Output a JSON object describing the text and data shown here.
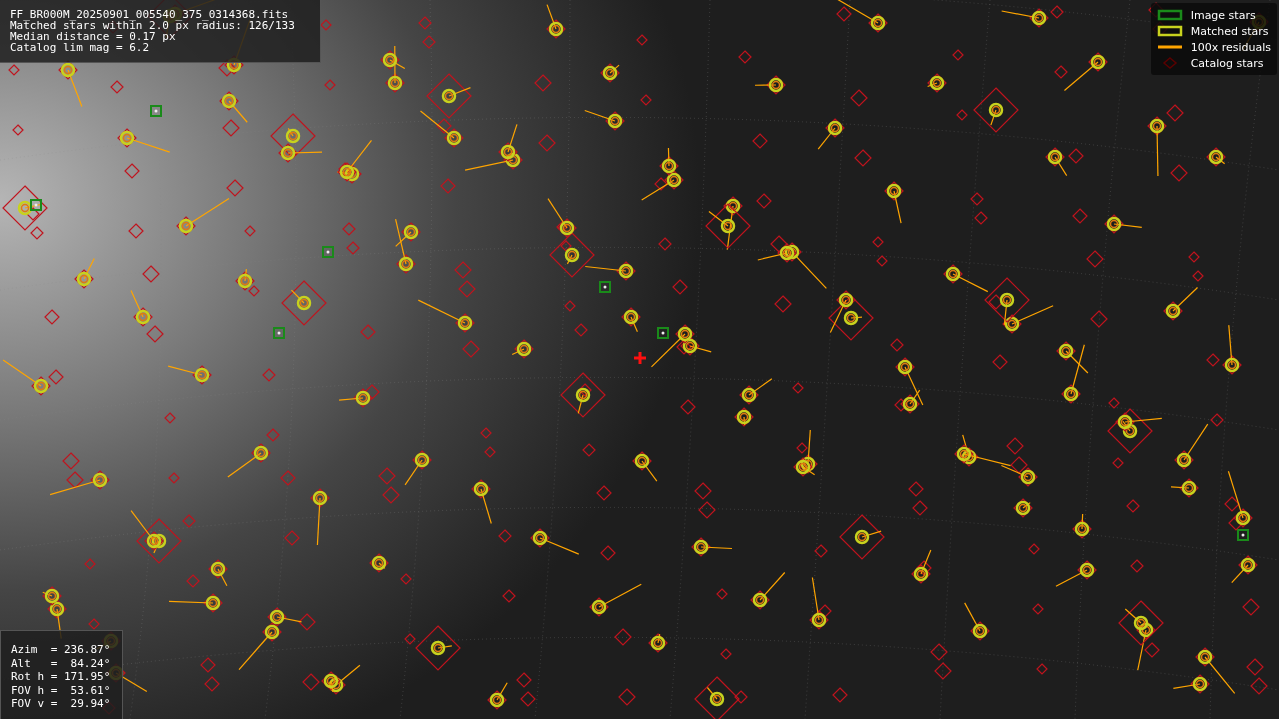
{
  "info_box": {
    "lines": [
      "FF_BR000M_20250901_005540_375_0314368.fits",
      "Matched stars within 2.0 px radius: 126/133",
      "Median distance = 0.17 px",
      "Catalog lim mag = 6.2"
    ]
  },
  "legend": {
    "items": [
      {
        "kind": "image",
        "label": "Image stars",
        "color": "#1a8a1a"
      },
      {
        "kind": "matched",
        "label": "Matched stars",
        "color": "#c8d21e"
      },
      {
        "kind": "residual",
        "label": "100x residuals",
        "color": "#ffa500"
      },
      {
        "kind": "catalog",
        "label": "Catalog stars",
        "color": "#5a0000"
      }
    ]
  },
  "pointing_box": {
    "lines": [
      "Azim  = 236.87°",
      "Alt   =  84.24°",
      "Rot h = 171.95°",
      "FOV h =  53.61°",
      "FOV v =  29.94°"
    ]
  }
}
